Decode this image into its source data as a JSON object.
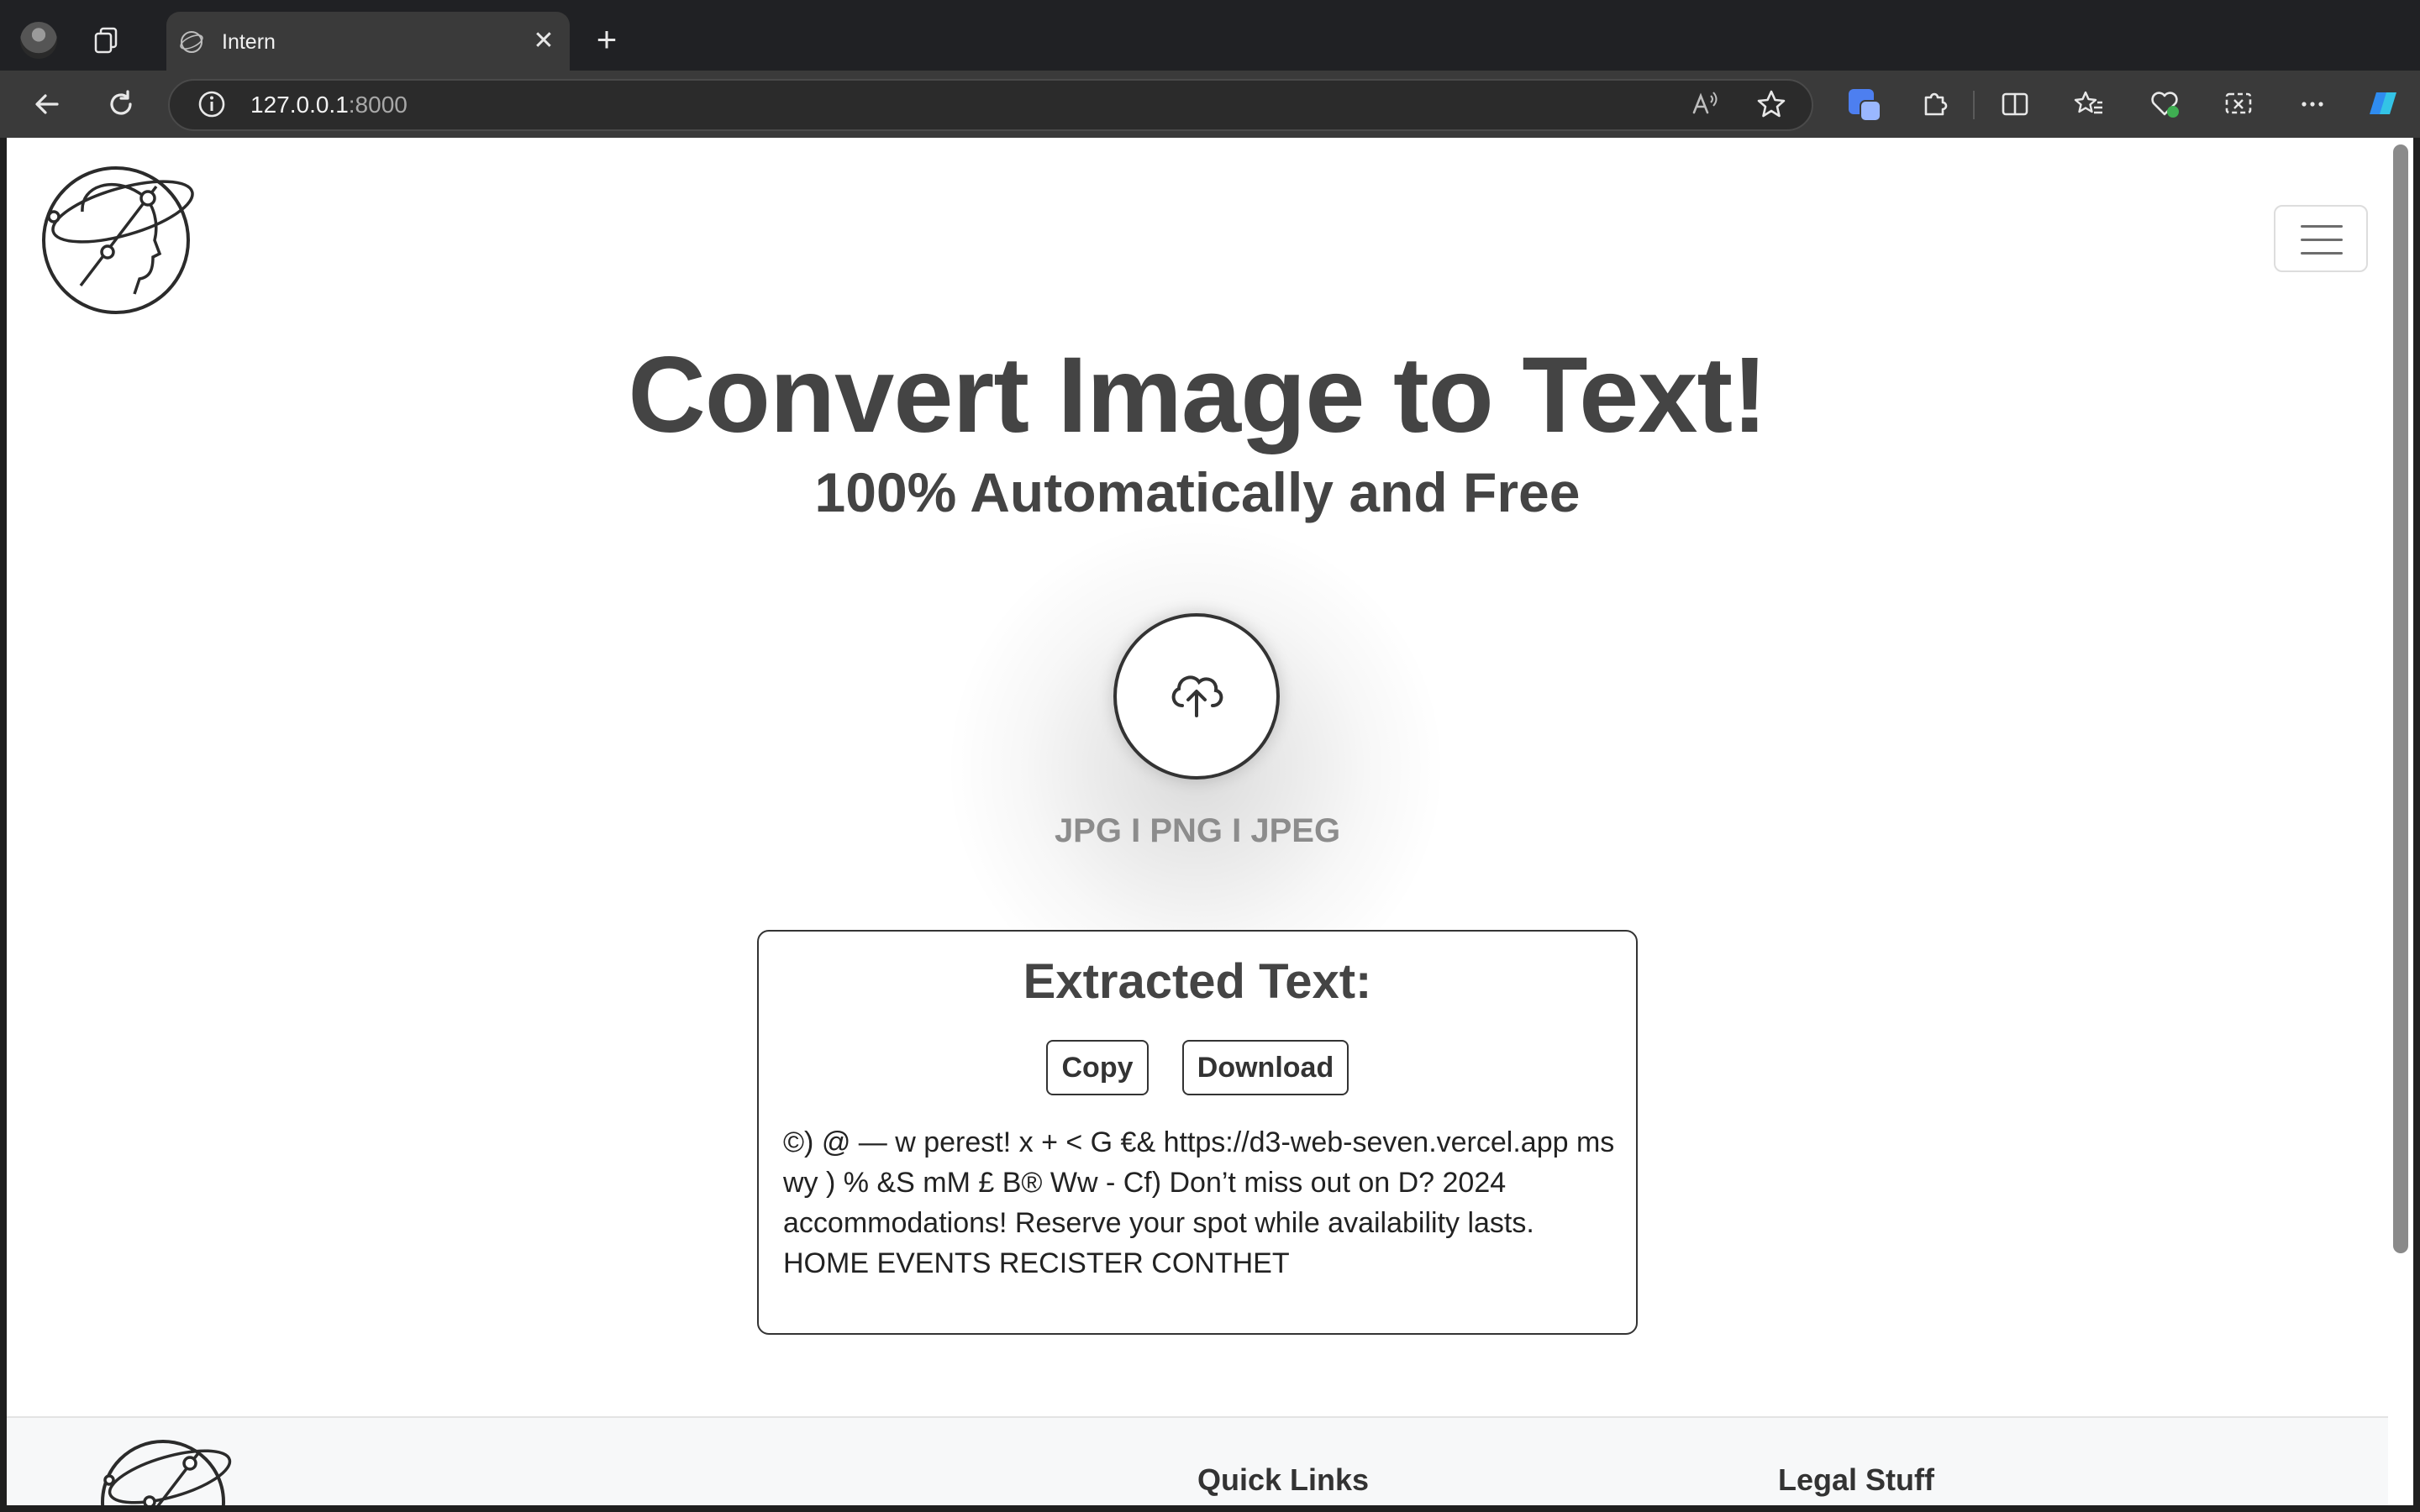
{
  "browser": {
    "tab_title": "Intern",
    "tab_close": "✕",
    "new_tab": "+",
    "url_host": "127.0.0.1",
    "url_port": ":8000"
  },
  "page": {
    "title": "Convert Image to Text!",
    "subtitle": "100% Automatically and Free",
    "formats": "JPG I PNG I JPEG",
    "result": {
      "heading": "Extracted Text:",
      "copy_label": "Copy",
      "download_label": "Download",
      "text": "©) @ — w perest! x + < G €& https://d3-web-seven.vercel.app ms wy ) % &S mM £ B® Ww - Cf) Don’t miss out on D? 2024 accommodations! Reserve your spot while availability lasts. HOME EVENTS RECISTER CONTHET"
    },
    "footer": {
      "quick_links": "Quick Links",
      "legal": "Legal Stuff"
    }
  },
  "icons": [
    "profile-avatar",
    "tab-actions-icon",
    "globe-icon",
    "back-icon",
    "reload-icon",
    "info-icon",
    "read-aloud-icon",
    "favorite-star-icon",
    "copilot-icon",
    "extensions-icon",
    "split-screen-icon",
    "favorites-icon",
    "browser-essentials-icon",
    "screenshot-icon",
    "more-icon",
    "edge-copilot-icon",
    "logo-head-icon",
    "hamburger-icon",
    "cloud-upload-icon"
  ]
}
